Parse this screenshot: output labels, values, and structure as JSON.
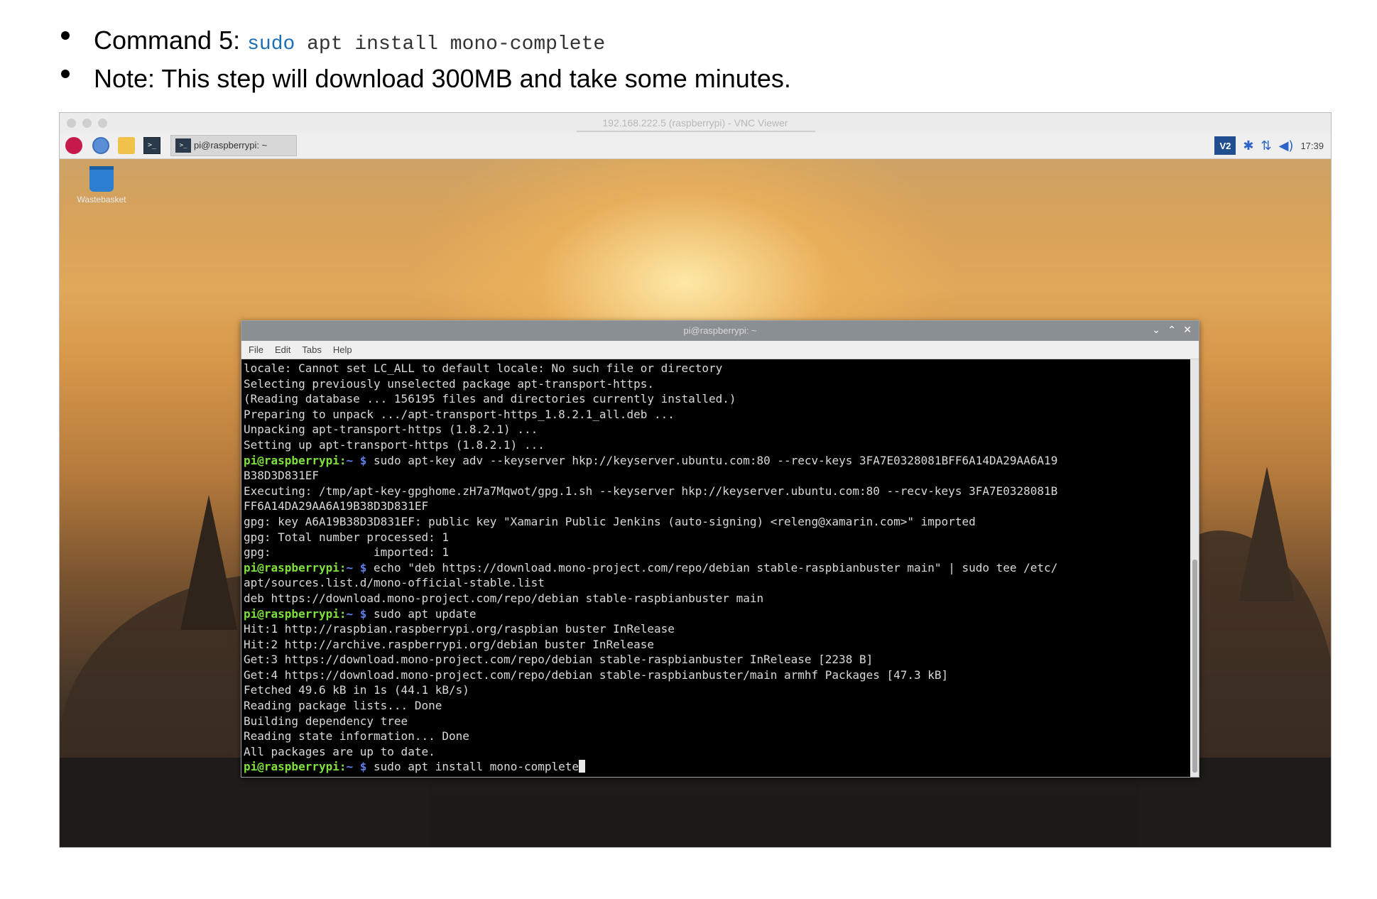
{
  "slide": {
    "bullet1_label": "Command 5:",
    "bullet1_code_kw": "sudo",
    "bullet1_code_rest": " apt install mono-complete",
    "bullet2_text": "Note: This step will download 300MB and take some minutes."
  },
  "vnc": {
    "window_title": "192.168.222.5 (raspberrypi) - VNC Viewer"
  },
  "taskbar": {
    "task_label": "pi@raspberrypi: ~",
    "vnc_badge": "V2",
    "clock": "17:39"
  },
  "desktop": {
    "wastebasket_label": "Wastebasket"
  },
  "terminal": {
    "title": "pi@raspberrypi: ~",
    "menu": [
      "File",
      "Edit",
      "Tabs",
      "Help"
    ],
    "prompt_user": "pi@raspberrypi:",
    "prompt_path": "~ $",
    "lines": [
      "locale: Cannot set LC_ALL to default locale: No such file or directory",
      "Selecting previously unselected package apt-transport-https.",
      "(Reading database ... 156195 files and directories currently installed.)",
      "Preparing to unpack .../apt-transport-https_1.8.2.1_all.deb ...",
      "Unpacking apt-transport-https (1.8.2.1) ...",
      "Setting up apt-transport-https (1.8.2.1) ...",
      " sudo apt-key adv --keyserver hkp://keyserver.ubuntu.com:80 --recv-keys 3FA7E0328081BFF6A14DA29AA6A19",
      "B38D3D831EF",
      "Executing: /tmp/apt-key-gpghome.zH7a7Mqwot/gpg.1.sh --keyserver hkp://keyserver.ubuntu.com:80 --recv-keys 3FA7E0328081B",
      "FF6A14DA29AA6A19B38D3D831EF",
      "gpg: key A6A19B38D3D831EF: public key \"Xamarin Public Jenkins (auto-signing) <releng@xamarin.com>\" imported",
      "gpg: Total number processed: 1",
      "gpg:               imported: 1",
      " echo \"deb https://download.mono-project.com/repo/debian stable-raspbianbuster main\" | sudo tee /etc/",
      "apt/sources.list.d/mono-official-stable.list",
      "deb https://download.mono-project.com/repo/debian stable-raspbianbuster main",
      " sudo apt update",
      "Hit:1 http://raspbian.raspberrypi.org/raspbian buster InRelease",
      "Hit:2 http://archive.raspberrypi.org/debian buster InRelease",
      "Get:3 https://download.mono-project.com/repo/debian stable-raspbianbuster InRelease [2238 B]",
      "Get:4 https://download.mono-project.com/repo/debian stable-raspbianbuster/main armhf Packages [47.3 kB]",
      "Fetched 49.6 kB in 1s (44.1 kB/s)",
      "Reading package lists... Done",
      "Building dependency tree",
      "Reading state information... Done",
      "All packages are up to date.",
      " sudo apt install mono-complete"
    ]
  },
  "colors": {
    "prompt_green": "#7ee23a",
    "path_blue": "#5d7fe6",
    "code_keyword": "#1a6fb5"
  }
}
